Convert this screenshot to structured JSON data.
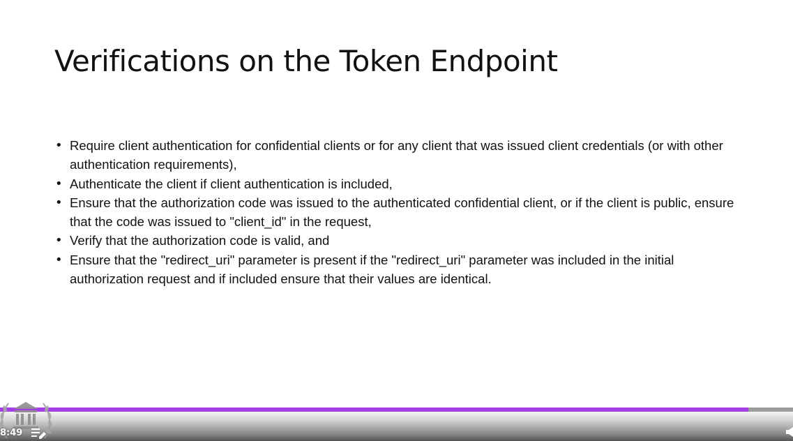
{
  "slide": {
    "title": "Verifications on the Token Endpoint",
    "bullets": [
      "Require client authentication for confidential clients or for any client that was issued client credentials (or with other authentication requirements),",
      "Authenticate the client if client authentication is included,",
      "Ensure that the authorization code was issued to the authenticated confidential client, or if the client is public, ensure that the code was issued to \"client_id\" in the request,",
      "Verify that the authorization code is valid, and",
      "Ensure that the \"redirect_uri\" parameter is present if the \"redirect_uri\" parameter was included in the initial authorization request and if included ensure that their values are identical."
    ]
  },
  "player": {
    "progress_fraction": 0.944,
    "elapsed_time": "8:49",
    "colors": {
      "progress_fill": "#a43fe6",
      "progress_track": "#9c9c9c"
    },
    "icons": [
      "laurel-logo-icon",
      "playlist-edit-icon",
      "volume-icon"
    ]
  }
}
